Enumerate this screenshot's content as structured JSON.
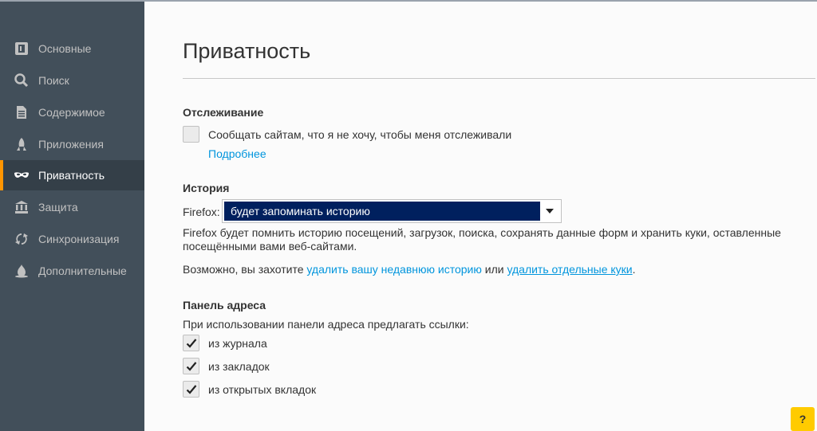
{
  "sidebar": {
    "items": [
      {
        "label": "Основные",
        "icon": "general-icon"
      },
      {
        "label": "Поиск",
        "icon": "search-icon"
      },
      {
        "label": "Содержимое",
        "icon": "content-icon"
      },
      {
        "label": "Приложения",
        "icon": "applications-icon"
      },
      {
        "label": "Приватность",
        "icon": "privacy-mask-icon",
        "selected": true
      },
      {
        "label": "Защита",
        "icon": "security-icon"
      },
      {
        "label": "Синхронизация",
        "icon": "sync-icon"
      },
      {
        "label": "Дополнительные",
        "icon": "advanced-icon"
      }
    ]
  },
  "main": {
    "title": "Приватность",
    "tracking": {
      "heading": "Отслеживание",
      "checkbox_label": "Сообщать сайтам, что я не хочу, чтобы меня отслеживали",
      "checked": false,
      "learn_more": "Подробнее"
    },
    "history": {
      "heading": "История",
      "firefox_label": "Firefox:",
      "select_value": "будет запоминать историю",
      "desc_line1": "Firefox будет помнить историю посещений, загрузок, поиска, сохранять данные форм и хранить куки, оставленные",
      "desc_line2": "посещёнными вами веб-сайтами.",
      "maybe_prefix": "Возможно, вы захотите ",
      "clear_history_link": "удалить вашу недавнюю историю",
      "or_text": " или ",
      "remove_cookies_link": "удалить отдельные куки",
      "period": "."
    },
    "address_bar": {
      "heading": "Панель адреса",
      "intro": "При использовании панели адреса предлагать ссылки:",
      "options": [
        {
          "label": "из журнала",
          "checked": true
        },
        {
          "label": "из закладок",
          "checked": true
        },
        {
          "label": "из открытых вкладок",
          "checked": true
        }
      ]
    },
    "help_label": "?"
  },
  "colors": {
    "sidebar": "#424f5a",
    "selected_bg": "#343f48",
    "accent": "#ff9500",
    "link": "#0095dd",
    "select_highlight": "#00205e",
    "help": "#ffcb00"
  }
}
